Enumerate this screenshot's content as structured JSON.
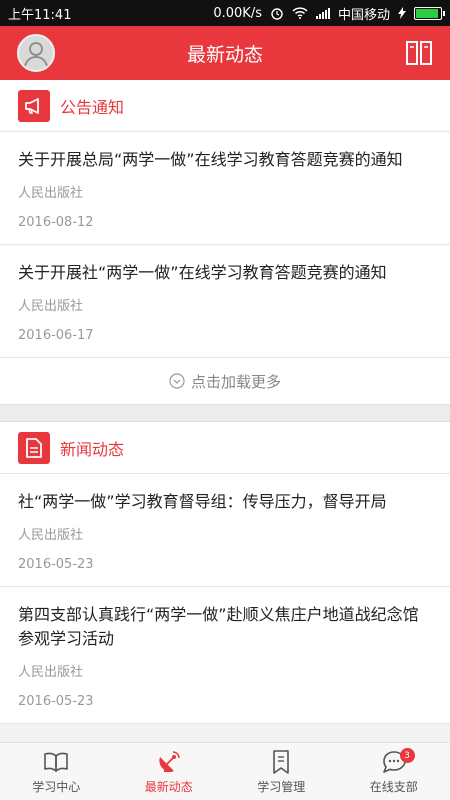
{
  "status_bar": {
    "time": "上午11:41",
    "speed": "0.00K/s",
    "carrier": "中国移动"
  },
  "header": {
    "title": "最新动态"
  },
  "announcements": {
    "title": "公告通知",
    "items": [
      {
        "title": "关于开展总局“两学一做”在线学习教育答题竞赛的通知",
        "source": "人民出版社",
        "date": "2016-08-12"
      },
      {
        "title": "关于开展社“两学一做”在线学习教育答题竞赛的通知",
        "source": "人民出版社",
        "date": "2016-06-17"
      }
    ],
    "load_more": "点击加载更多"
  },
  "news": {
    "title": "新闻动态",
    "items": [
      {
        "title": "社“两学一做”学习教育督导组：传导压力，督导开局",
        "source": "人民出版社",
        "date": "2016-05-23"
      },
      {
        "title": "第四支部认真践行“两学一做”赴顺义焦庄户地道战纪念馆参观学习活动",
        "source": "人民出版社",
        "date": "2016-05-23"
      }
    ]
  },
  "tabs": [
    {
      "label": "学习中心",
      "icon": "book-icon"
    },
    {
      "label": "最新动态",
      "icon": "satellite-dish-icon",
      "active": true
    },
    {
      "label": "学习管理",
      "icon": "bookmark-icon"
    },
    {
      "label": "在线支部",
      "icon": "chat-icon",
      "badge": "3"
    }
  ],
  "colors": {
    "accent": "#e8383d"
  }
}
